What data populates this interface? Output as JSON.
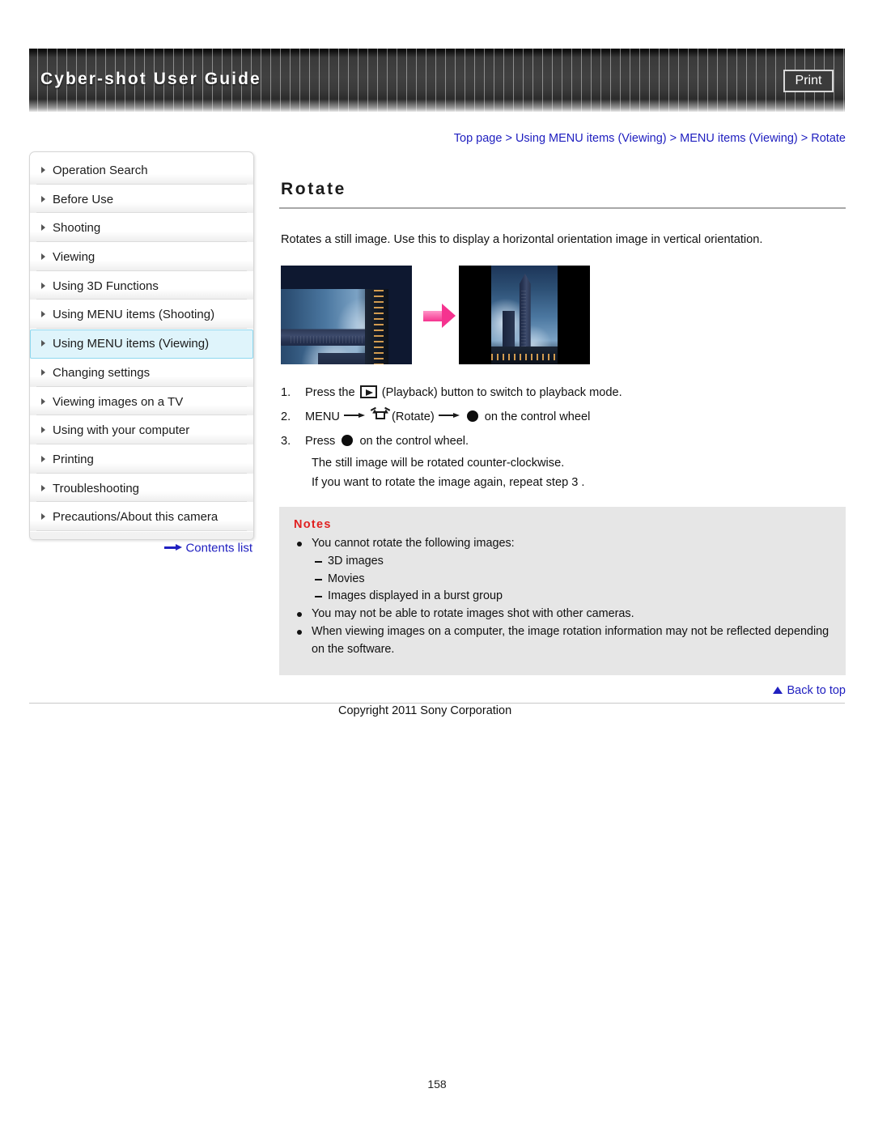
{
  "header": {
    "title": "Cyber-shot User Guide",
    "print_label": "Print"
  },
  "breadcrumb": {
    "items": [
      "Top page",
      "Using MENU items (Viewing)",
      "MENU items (Viewing)",
      "Rotate"
    ],
    "separator": ">",
    "full_text": "Top page > Using MENU items (Viewing) > MENU items (Viewing) > Rotate"
  },
  "sidebar": {
    "items": [
      {
        "label": "Operation Search",
        "active": false
      },
      {
        "label": "Before Use",
        "active": false
      },
      {
        "label": "Shooting",
        "active": false
      },
      {
        "label": "Viewing",
        "active": false
      },
      {
        "label": "Using 3D Functions",
        "active": false
      },
      {
        "label": "Using MENU items (Shooting)",
        "active": false
      },
      {
        "label": "Using MENU items (Viewing)",
        "active": true
      },
      {
        "label": "Changing settings",
        "active": false
      },
      {
        "label": "Viewing images on a TV",
        "active": false
      },
      {
        "label": "Using with your computer",
        "active": false
      },
      {
        "label": "Printing",
        "active": false
      },
      {
        "label": "Troubleshooting",
        "active": false
      },
      {
        "label": "Precautions/About this camera",
        "active": false
      }
    ],
    "contents_list_label": "Contents list"
  },
  "main": {
    "title": "Rotate",
    "intro": "Rotates a still image. Use this to display a horizontal orientation image in vertical orientation.",
    "steps": [
      {
        "number": "1.",
        "parts": [
          "Press the ",
          "[playback-icon]",
          " (Playback) button to switch to playback mode."
        ],
        "pre": "Press the",
        "post": "(Playback) button to switch to playback mode."
      },
      {
        "number": "2.",
        "pre": "MENU",
        "mid": "(Rotate)",
        "post": "on the control wheel"
      },
      {
        "number": "3.",
        "pre": "Press",
        "post": "on the control wheel."
      }
    ],
    "step3_detail": [
      "The still image will be rotated counter-clockwise.",
      "If you want to rotate the image again, repeat step 3 ."
    ],
    "notes": {
      "title": "Notes",
      "items": [
        {
          "text": "You cannot rotate the following images:",
          "sub": [
            "3D images",
            "Movies",
            "Images displayed in a burst group"
          ]
        },
        {
          "text": "You may not be able to rotate images shot with other cameras.",
          "sub": []
        },
        {
          "text": "When viewing images on a computer, the image rotation information may not be reflected depending on the software.",
          "sub": []
        }
      ]
    }
  },
  "footer": {
    "back_to_top": "Back to top",
    "copyright": "Copyright 2011 Sony Corporation",
    "page_number": "158"
  },
  "colors": {
    "link": "#2020c0",
    "notes_title": "#e02020",
    "notes_background": "#e6e6e6",
    "active_nav_background": "#dff4fb",
    "active_nav_border": "#8ed8ef",
    "arrow_pink": "#f5338f"
  }
}
